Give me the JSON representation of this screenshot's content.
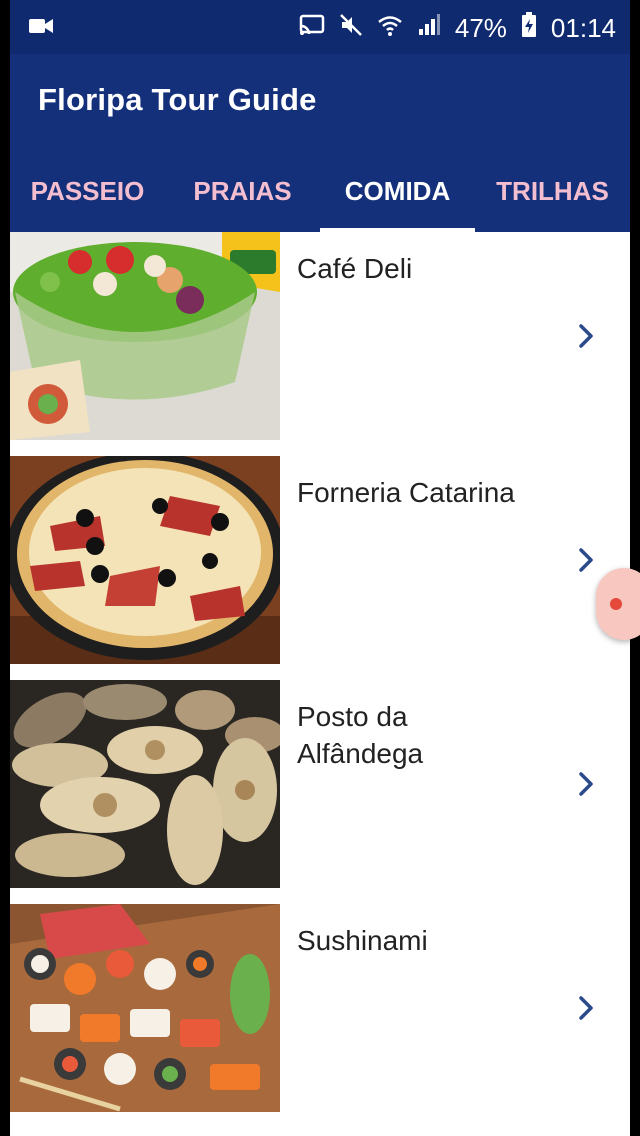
{
  "status": {
    "battery": "47%",
    "time": "01:14"
  },
  "app": {
    "title": "Floripa Tour Guide"
  },
  "tabs": [
    {
      "label": "PASSEIO",
      "active": false
    },
    {
      "label": "PRAIAS",
      "active": false
    },
    {
      "label": "COMIDA",
      "active": true
    },
    {
      "label": "TRILHAS",
      "active": false
    }
  ],
  "places": [
    {
      "name": "Café Deli",
      "image": "salad-bowl-photo"
    },
    {
      "name": "Forneria Catarina",
      "image": "pizza-photo"
    },
    {
      "name": "Posto da Alfândega",
      "image": "oysters-photo"
    },
    {
      "name": "Sushinami",
      "image": "sushi-platter-photo"
    }
  ],
  "colors": {
    "primary": "#14307a",
    "status_bar": "#0f2a6e",
    "tab_inactive": "#f3bfd0",
    "chevron": "#2a4a8a"
  },
  "icons": [
    "video-icon",
    "cast-icon",
    "mute-icon",
    "wifi-icon",
    "signal-icon",
    "battery-icon",
    "chevron-right-icon"
  ]
}
